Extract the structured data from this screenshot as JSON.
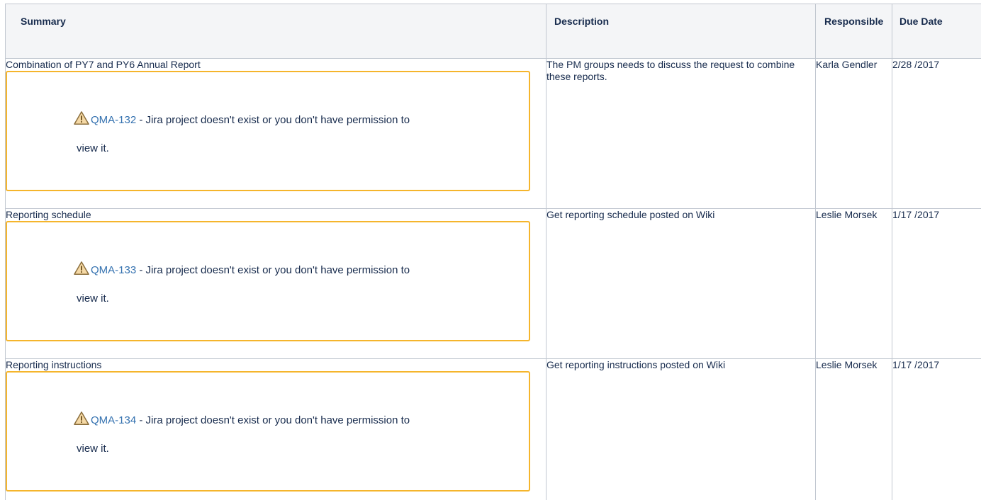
{
  "table": {
    "headers": {
      "summary": "Summary",
      "description": "Description",
      "responsible": "Responsible",
      "due_date": "Due Date"
    },
    "rows": [
      {
        "summary": "Combination of PY7 and PY6 Annual Report",
        "issue_key": "QMA-132",
        "issue_message": " - Jira project doesn't exist or you don't have permission to",
        "issue_message_cont": "view it.",
        "description": "The PM groups needs to discuss the request to combine these reports.",
        "responsible": "Karla Gendler",
        "due_date": "2/28 /2017"
      },
      {
        "summary": "Reporting schedule",
        "issue_key": "QMA-133",
        "issue_message": " - Jira project doesn't exist or you don't have permission to",
        "issue_message_cont": "view it.",
        "description": "Get reporting schedule posted on Wiki",
        "responsible": "Leslie Morsek",
        "due_date": "1/17 /2017"
      },
      {
        "summary": "Reporting instructions",
        "issue_key": "QMA-134",
        "issue_message": " - Jira project doesn't exist or you don't have permission to",
        "issue_message_cont": "view it.",
        "description": "Get reporting instructions posted on Wiki",
        "responsible": "Leslie Morsek",
        "due_date": "1/17 /2017"
      }
    ]
  },
  "icons": {
    "warning": "warning-triangle-icon"
  },
  "colors": {
    "link": "#3572b0",
    "warning_border": "#f5b52c",
    "header_bg": "#f4f5f7",
    "grid": "#c1c7d0"
  }
}
